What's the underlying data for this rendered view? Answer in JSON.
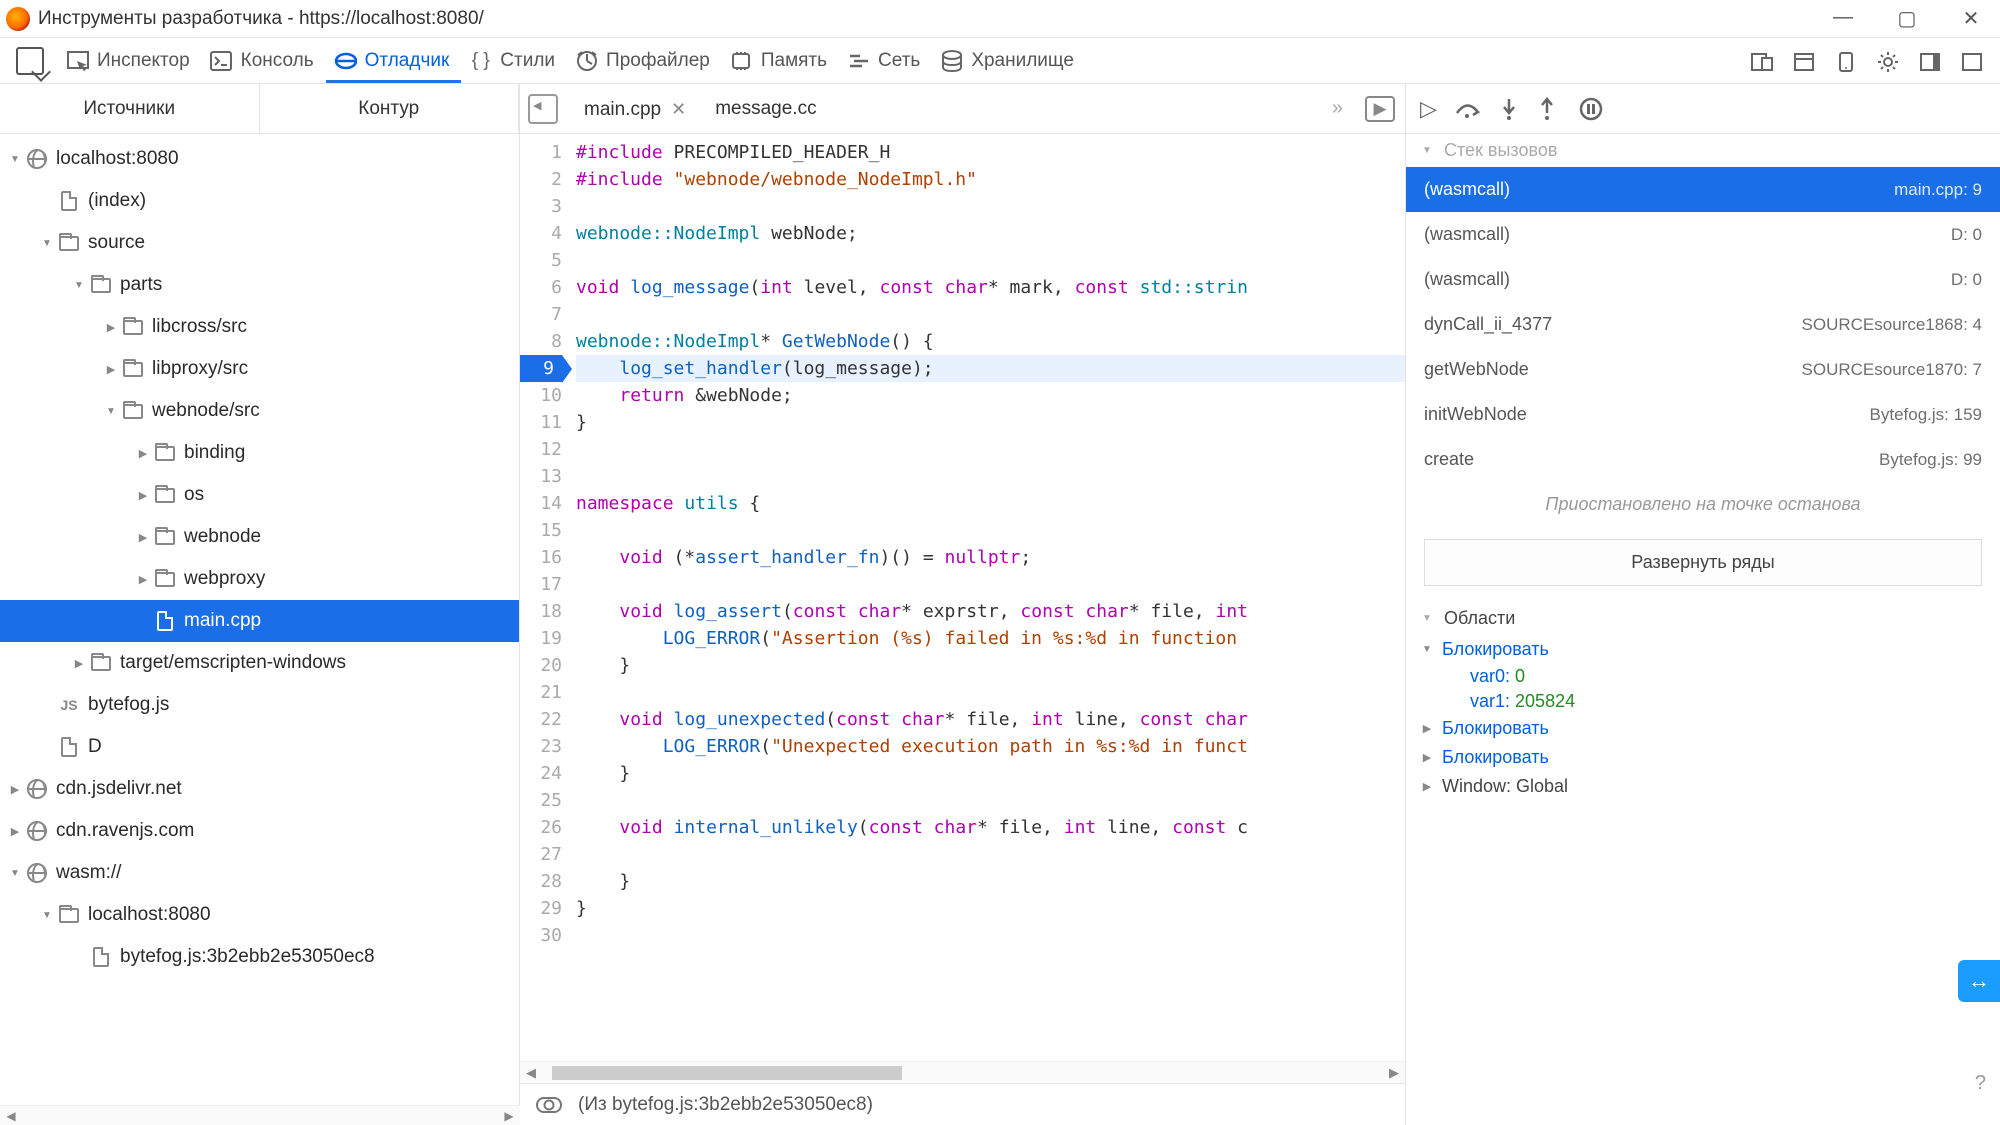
{
  "window": {
    "title": "Инструменты разработчика - https://localhost:8080/"
  },
  "tools": [
    {
      "id": "inspector",
      "label": "Инспектор"
    },
    {
      "id": "console",
      "label": "Консоль"
    },
    {
      "id": "debugger",
      "label": "Отладчик"
    },
    {
      "id": "styles",
      "label": "Стили"
    },
    {
      "id": "profiler",
      "label": "Профайлер"
    },
    {
      "id": "memory",
      "label": "Память"
    },
    {
      "id": "network",
      "label": "Сеть"
    },
    {
      "id": "storage",
      "label": "Хранилище"
    }
  ],
  "tools_active": "debugger",
  "sources": {
    "tabs": [
      "Источники",
      "Контур"
    ],
    "tree": [
      {
        "d": 0,
        "tw": "open",
        "icon": "globe",
        "label": "localhost:8080"
      },
      {
        "d": 1,
        "tw": "none",
        "icon": "file",
        "label": "(index)"
      },
      {
        "d": 1,
        "tw": "open",
        "icon": "folder",
        "label": "source"
      },
      {
        "d": 2,
        "tw": "open",
        "icon": "folder",
        "label": "parts"
      },
      {
        "d": 3,
        "tw": "closed",
        "icon": "folder",
        "label": "libcross/src"
      },
      {
        "d": 3,
        "tw": "closed",
        "icon": "folder",
        "label": "libproxy/src"
      },
      {
        "d": 3,
        "tw": "open",
        "icon": "folder",
        "label": "webnode/src"
      },
      {
        "d": 4,
        "tw": "closed",
        "icon": "folder",
        "label": "binding"
      },
      {
        "d": 4,
        "tw": "closed",
        "icon": "folder",
        "label": "os"
      },
      {
        "d": 4,
        "tw": "closed",
        "icon": "folder",
        "label": "webnode"
      },
      {
        "d": 4,
        "tw": "closed",
        "icon": "folder",
        "label": "webproxy"
      },
      {
        "d": 4,
        "tw": "none",
        "icon": "file",
        "label": "main.cpp",
        "sel": true
      },
      {
        "d": 2,
        "tw": "closed",
        "icon": "folder",
        "label": "target/emscripten-windows"
      },
      {
        "d": 1,
        "tw": "none",
        "icon": "js",
        "label": "bytefog.js"
      },
      {
        "d": 1,
        "tw": "none",
        "icon": "file",
        "label": "D"
      },
      {
        "d": 0,
        "tw": "closed",
        "icon": "globe",
        "label": "cdn.jsdelivr.net"
      },
      {
        "d": 0,
        "tw": "closed",
        "icon": "globe",
        "label": "cdn.ravenjs.com"
      },
      {
        "d": 0,
        "tw": "open",
        "icon": "globe",
        "label": "wasm://"
      },
      {
        "d": 1,
        "tw": "open",
        "icon": "folder",
        "label": "localhost:8080"
      },
      {
        "d": 2,
        "tw": "none",
        "icon": "file",
        "label": "bytefog.js:3b2ebb2e53050ec8"
      }
    ]
  },
  "editor": {
    "tabs": [
      {
        "name": "main.cpp",
        "closable": true,
        "active": true
      },
      {
        "name": "message.cc",
        "closable": false,
        "active": false
      }
    ],
    "breakpoint_line": 9,
    "lines": [
      {
        "n": 1,
        "h": "<span class=kw>#include</span> PRECOMPILED_HEADER_H"
      },
      {
        "n": 2,
        "h": "<span class=kw>#include</span> <span class=str>\"webnode/webnode_NodeImpl.h\"</span>"
      },
      {
        "n": 3,
        "h": ""
      },
      {
        "n": 4,
        "h": "<span class=type>webnode::NodeImpl</span> webNode;"
      },
      {
        "n": 5,
        "h": ""
      },
      {
        "n": 6,
        "h": "<span class=kw>void</span> <span class=fn>log_message</span>(<span class=kw>int</span> level, <span class=kw>const</span> <span class=kw>char</span>* mark, <span class=kw>const</span> <span class=type>std::strin</span>"
      },
      {
        "n": 7,
        "h": ""
      },
      {
        "n": 8,
        "h": "<span class=type>webnode::NodeImpl</span>* <span class=fn>GetWebNode</span>() {"
      },
      {
        "n": 9,
        "h": "    <span class=fn>log_set_handler</span>(log_message);",
        "hl": true
      },
      {
        "n": 10,
        "h": "    <span class=kw>return</span> &amp;webNode;"
      },
      {
        "n": 11,
        "h": "}"
      },
      {
        "n": 12,
        "h": ""
      },
      {
        "n": 13,
        "h": ""
      },
      {
        "n": 14,
        "h": "<span class=kw>namespace</span> <span class=type>utils</span> {"
      },
      {
        "n": 15,
        "h": ""
      },
      {
        "n": 16,
        "h": "    <span class=kw>void</span> (*<span class=fn>assert_handler_fn</span>)() = <span class=kw>nullptr</span>;"
      },
      {
        "n": 17,
        "h": ""
      },
      {
        "n": 18,
        "h": "    <span class=kw>void</span> <span class=fn>log_assert</span>(<span class=kw>const</span> <span class=kw>char</span>* exprstr, <span class=kw>const</span> <span class=kw>char</span>* file, <span class=kw>int</span>"
      },
      {
        "n": 19,
        "h": "        <span class=fn>LOG_ERROR</span>(<span class=str>\"Assertion (%s) failed in %s:%d in function </span>"
      },
      {
        "n": 20,
        "h": "    }"
      },
      {
        "n": 21,
        "h": ""
      },
      {
        "n": 22,
        "h": "    <span class=kw>void</span> <span class=fn>log_unexpected</span>(<span class=kw>const</span> <span class=kw>char</span>* file, <span class=kw>int</span> line, <span class=kw>const</span> <span class=kw>char</span>"
      },
      {
        "n": 23,
        "h": "        <span class=fn>LOG_ERROR</span>(<span class=str>\"Unexpected execution path in %s:%d in funct</span>"
      },
      {
        "n": 24,
        "h": "    }"
      },
      {
        "n": 25,
        "h": ""
      },
      {
        "n": 26,
        "h": "    <span class=kw>void</span> <span class=fn>internal_unlikely</span>(<span class=kw>const</span> <span class=kw>char</span>* file, <span class=kw>int</span> line, <span class=kw>const</span> c"
      },
      {
        "n": 27,
        "h": ""
      },
      {
        "n": 28,
        "h": "    }"
      },
      {
        "n": 29,
        "h": "}"
      },
      {
        "n": 30,
        "h": ""
      }
    ]
  },
  "status": {
    "text": "(Из bytefog.js:3b2ebb2e53050ec8)",
    "help": "?"
  },
  "callstack": {
    "header": "Стек вызовов",
    "frames": [
      {
        "name": "(wasmcall)",
        "loc": "main.cpp: 9",
        "sel": true
      },
      {
        "name": "(wasmcall)",
        "loc": "D: 0"
      },
      {
        "name": "(wasmcall)",
        "loc": "D: 0"
      },
      {
        "name": "dynCall_ii_4377",
        "loc": "SOURCEsource1868: 4"
      },
      {
        "name": "getWebNode",
        "loc": "SOURCEsource1870: 7"
      },
      {
        "name": "initWebNode",
        "loc": "Bytefog.js: 159"
      },
      {
        "name": "create",
        "loc": "Bytefog.js: 99"
      }
    ],
    "pause_msg": "Приостановлено на точке останова",
    "expand_label": "Развернуть ряды"
  },
  "scopes": {
    "header": "Области",
    "items": [
      {
        "tw": "open",
        "label": "Блокировать",
        "vars": [
          {
            "name": "var0",
            "value": "0"
          },
          {
            "name": "var1",
            "value": "205824"
          }
        ]
      },
      {
        "tw": "closed",
        "label": "Блокировать"
      },
      {
        "tw": "closed",
        "label": "Блокировать"
      },
      {
        "tw": "closed",
        "label": "Window: Global",
        "win": true
      }
    ]
  }
}
